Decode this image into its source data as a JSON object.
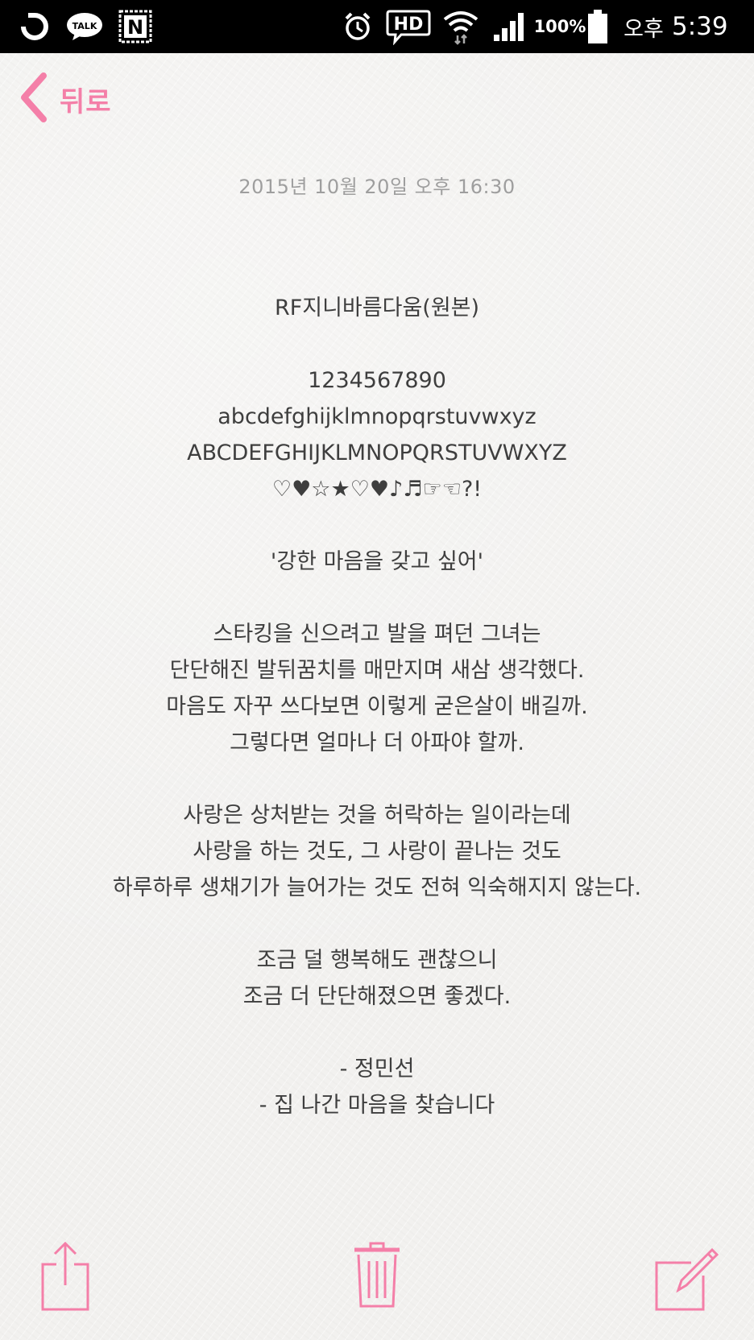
{
  "status_bar": {
    "battery_percent": "100%",
    "ampm": "오후",
    "time": "5:39",
    "hd_label": "HD",
    "talk_label": "TALK",
    "n_label": "N"
  },
  "nav": {
    "back_label": "뒤로"
  },
  "note": {
    "date": "2015년 10월 20일 오후 16:30",
    "lines": [
      "RF지니바름다움(원본)",
      "",
      "1234567890",
      "abcdefghijklmnopqrstuvwxyz",
      "ABCDEFGHIJKLMNOPQRSTUVWXYZ",
      "♡♥☆★♡♥♪♬☞☜?!",
      "",
      "'강한 마음을 갖고 싶어'",
      "",
      "스타킹을 신으려고 발을 펴던 그녀는",
      "단단해진 발뒤꿈치를 매만지며 새삼 생각했다.",
      "마음도 자꾸 쓰다보면 이렇게 굳은살이 배길까.",
      "그렇다면 얼마나 더 아파야 할까.",
      "",
      "사랑은 상처받는 것을 허락하는 일이라는데",
      "사랑을 하는 것도, 그 사랑이 끝나는 것도",
      "하루하루 생채기가 늘어가는 것도 전혀 익숙해지지 않는다.",
      "",
      "조금 덜 행복해도 괜찮으니",
      "조금 더 단단해졌으면 좋겠다.",
      "",
      "- 정민선",
      "- 집 나간 마음을 찾습니다"
    ]
  },
  "colors": {
    "accent": "#f47fa8",
    "text": "#3e3e3e",
    "date": "#9e9e9e"
  }
}
